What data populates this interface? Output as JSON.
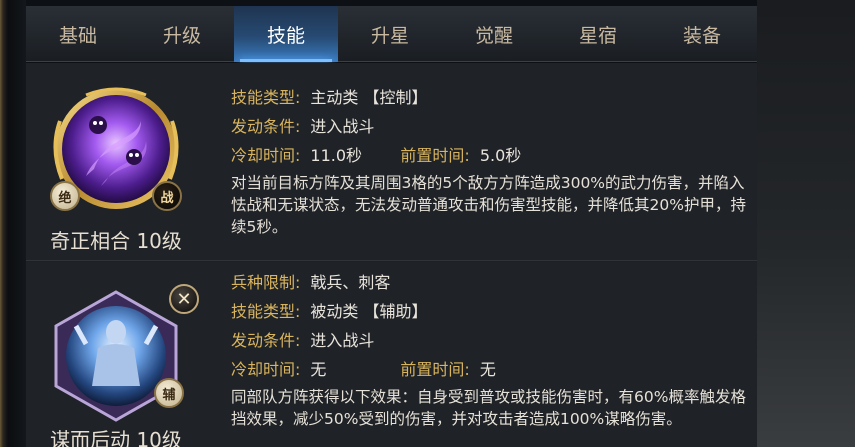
{
  "tabs": [
    {
      "label": "基础"
    },
    {
      "label": "升级"
    },
    {
      "label": "技能"
    },
    {
      "label": "升星"
    },
    {
      "label": "觉醒"
    },
    {
      "label": "星宿"
    },
    {
      "label": "装备"
    }
  ],
  "active_tab": "技能",
  "skills": [
    {
      "name": "奇正相合 10级",
      "icon": "purple-spirit-swirl-icon",
      "badges": [
        "绝",
        "战"
      ],
      "rows": [
        {
          "label": "技能类型:",
          "value": "主动类 【控制】"
        },
        {
          "label": "发动条件:",
          "value": "进入战斗"
        },
        {
          "label": "冷却时间:",
          "value": "11.0秒",
          "label2": "前置时间:",
          "value2": "5.0秒"
        }
      ],
      "description": "对当前目标方阵及其周围3格的5个敌方方阵造成300%的武力伤害，并陷入怯战和无谋状态，无法发动普通攻击和伤害型技能，并降低其20%护甲，持续5秒。"
    },
    {
      "name": "谋而后动 10级",
      "icon": "blue-ghost-warrior-icon",
      "badges": [
        "辅"
      ],
      "rows": [
        {
          "label": "兵种限制:",
          "value": "戟兵、刺客"
        },
        {
          "label": "技能类型:",
          "value": "被动类 【辅助】"
        },
        {
          "label": "发动条件:",
          "value": "进入战斗"
        },
        {
          "label": "冷却时间:",
          "value": "无",
          "label2": "前置时间:",
          "value2": "无"
        }
      ],
      "description": "同部队方阵获得以下效果：自身受到普攻或技能伤害时，有60%概率触发格挡效果，减少50%受到的伤害，并对攻击者造成100%谋略伤害。"
    }
  ],
  "colors": {
    "label_gold": "#d8b45e",
    "tab_active_blue": "#3b7cc0",
    "panel_bg": "#1f2226"
  }
}
